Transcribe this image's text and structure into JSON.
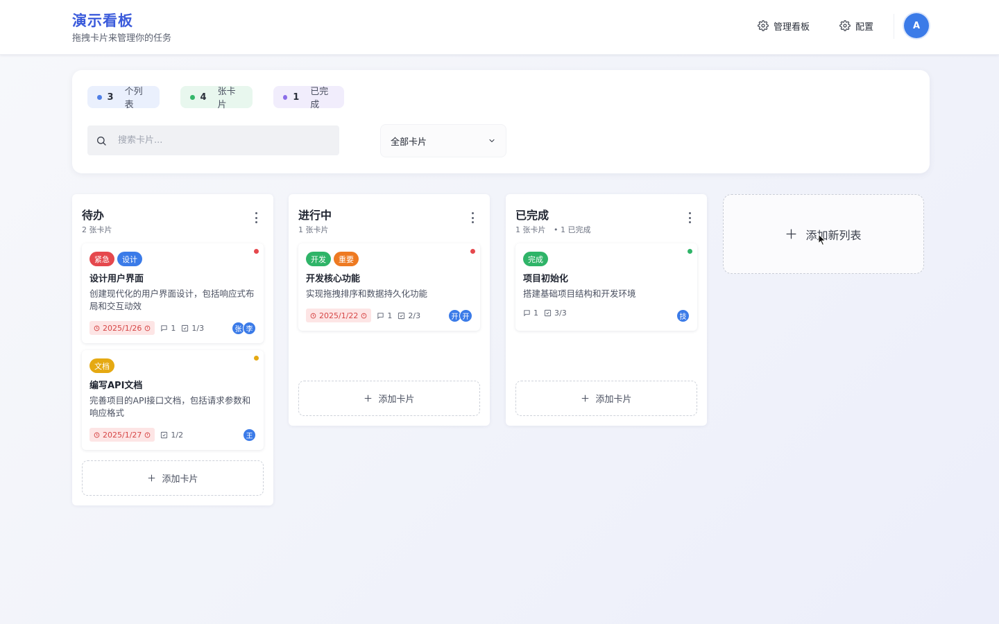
{
  "header": {
    "title": "演示看板",
    "subtitle": "拖拽卡片来管理你的任务",
    "manage_board_label": "管理看板",
    "config_label": "配置",
    "avatar_initial": "A",
    "icons": {
      "manage": "gear-icon",
      "config": "gear-icon"
    }
  },
  "stats": [
    {
      "count": "3",
      "label": "个列表",
      "color": "#4f7fe6",
      "bg": "#eaf0fd"
    },
    {
      "count": "4",
      "label": "张卡片",
      "color": "#34b76a",
      "bg": "#e8f7ee"
    },
    {
      "count": "1",
      "label": "已完成",
      "color": "#8b6ee8",
      "bg": "#f1edfc"
    }
  ],
  "search": {
    "placeholder": "搜索卡片...",
    "value": ""
  },
  "filter": {
    "selected": "全部卡片"
  },
  "columns": [
    {
      "title": "待办",
      "count_text": "2 张卡片",
      "done_text": "",
      "add_card_label": "添加卡片",
      "cards": [
        {
          "tags": [
            {
              "text": "紧急",
              "color": "#e5484d"
            },
            {
              "text": "设计",
              "color": "#3b7be8"
            }
          ],
          "priority_color": "#e5484d",
          "title": "设计用户界面",
          "description": "创建现代化的用户界面设计，包括响应式布局和交互动效",
          "due": "2025/1/26",
          "comments": "1",
          "checklist": "1/3",
          "members": [
            "张",
            "李"
          ]
        },
        {
          "tags": [
            {
              "text": "文档",
              "color": "#e5a912"
            }
          ],
          "priority_color": "#e5a912",
          "title": "编写API文档",
          "description": "完善项目的API接口文档，包括请求参数和响应格式",
          "due": "2025/1/27",
          "comments": "",
          "checklist": "1/2",
          "members": [
            "王"
          ]
        }
      ]
    },
    {
      "title": "进行中",
      "count_text": "1 张卡片",
      "done_text": "",
      "add_card_label": "添加卡片",
      "cards": [
        {
          "tags": [
            {
              "text": "开发",
              "color": "#2fb468"
            },
            {
              "text": "重要",
              "color": "#ee7a22"
            }
          ],
          "priority_color": "#e5484d",
          "title": "开发核心功能",
          "description": "实现拖拽排序和数据持久化功能",
          "due": "2025/1/22",
          "comments": "1",
          "checklist": "2/3",
          "members": [
            "开",
            "开"
          ]
        }
      ]
    },
    {
      "title": "已完成",
      "count_text": "1 张卡片",
      "done_text": "• 1 已完成",
      "add_card_label": "添加卡片",
      "cards": [
        {
          "tags": [
            {
              "text": "完成",
              "color": "#2fb468"
            }
          ],
          "priority_color": "#2fb468",
          "title": "项目初始化",
          "description": "搭建基础项目结构和开发环境",
          "due": "",
          "comments": "1",
          "checklist": "3/3",
          "members": [
            "技"
          ]
        }
      ]
    }
  ],
  "add_list_label": "添加新列表"
}
